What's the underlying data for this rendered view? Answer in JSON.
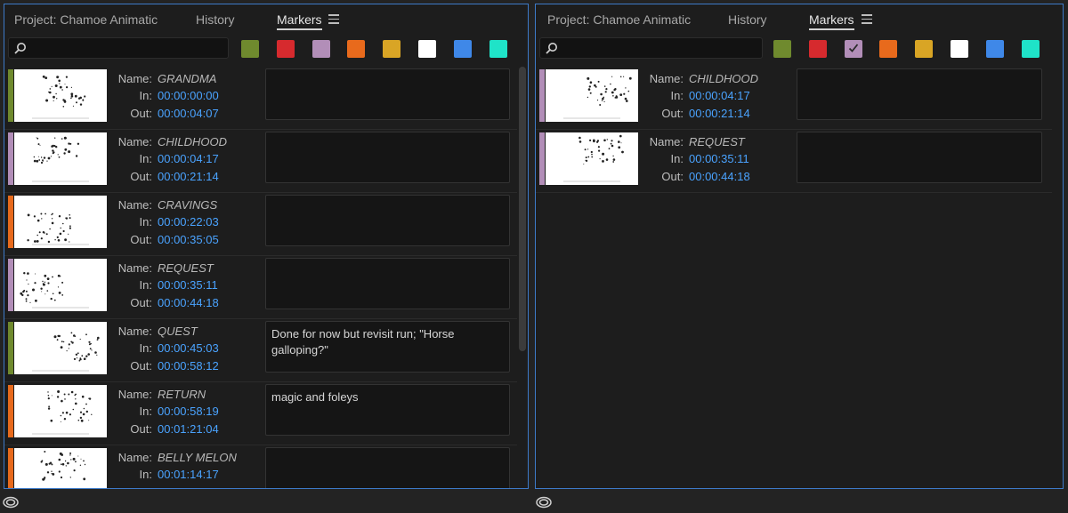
{
  "colors": {
    "accent": "#3d7ac8",
    "timecode": "#4aa3ff",
    "panel_bg": "#1d1d1d",
    "swatches": [
      "#6f8a2e",
      "#d62a2e",
      "#b28eb8",
      "#e86a1c",
      "#d9a525",
      "#ffffff",
      "#3f88e8",
      "#1fe3c8"
    ]
  },
  "labels": {
    "name": "Name:",
    "in": "In:",
    "out": "Out:"
  },
  "left_panel": {
    "tabs": [
      {
        "label": "Project: Chamoe Animatic"
      },
      {
        "label": "History"
      },
      {
        "label": "Markers"
      }
    ],
    "search": {
      "value": "",
      "placeholder": ""
    },
    "selected_filter": null,
    "markers": [
      {
        "color": "#6f8a2e",
        "name": "GRANDMA",
        "in": "00:00:00:00",
        "out": "00:00:04:07",
        "comment": ""
      },
      {
        "color": "#b28eb8",
        "name": "CHILDHOOD",
        "in": "00:00:04:17",
        "out": "00:00:21:14",
        "comment": ""
      },
      {
        "color": "#e86a1c",
        "name": "CRAVINGS",
        "in": "00:00:22:03",
        "out": "00:00:35:05",
        "comment": ""
      },
      {
        "color": "#b28eb8",
        "name": "REQUEST",
        "in": "00:00:35:11",
        "out": "00:00:44:18",
        "comment": ""
      },
      {
        "color": "#6f8a2e",
        "name": "QUEST",
        "in": "00:00:45:03",
        "out": "00:00:58:12",
        "comment": "Done for now but revisit run; \"Horse\ngalloping?\""
      },
      {
        "color": "#e86a1c",
        "name": "RETURN",
        "in": "00:00:58:19",
        "out": "00:01:21:04",
        "comment": "magic and foleys"
      },
      {
        "color": "#e86a1c",
        "name": "BELLY MELON",
        "in": "00:01:14:17",
        "out": "",
        "comment": ""
      }
    ]
  },
  "right_panel": {
    "tabs": [
      {
        "label": "Project: Chamoe Animatic"
      },
      {
        "label": "History"
      },
      {
        "label": "Markers"
      }
    ],
    "search": {
      "value": "",
      "placeholder": ""
    },
    "selected_filter": 2,
    "markers": [
      {
        "color": "#b28eb8",
        "name": "CHILDHOOD",
        "in": "00:00:04:17",
        "out": "00:00:21:14",
        "comment": ""
      },
      {
        "color": "#b28eb8",
        "name": "REQUEST",
        "in": "00:00:35:11",
        "out": "00:00:44:18",
        "comment": ""
      }
    ]
  }
}
